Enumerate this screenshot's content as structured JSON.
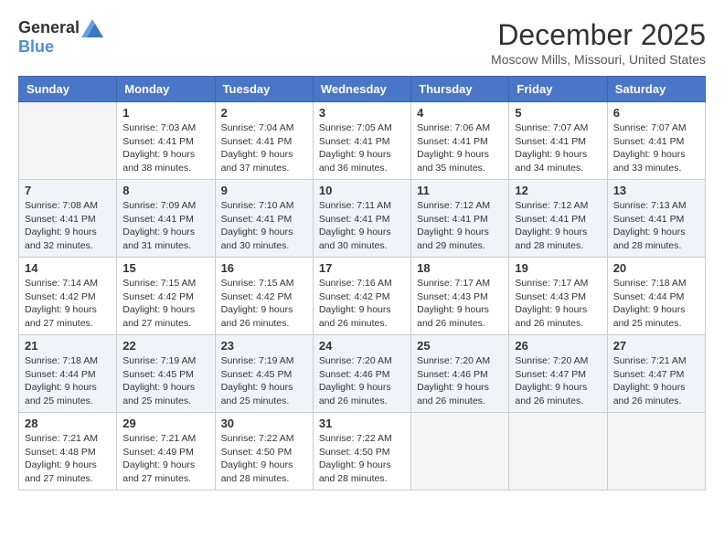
{
  "logo": {
    "general": "General",
    "blue": "Blue"
  },
  "title": "December 2025",
  "location": "Moscow Mills, Missouri, United States",
  "weekdays": [
    "Sunday",
    "Monday",
    "Tuesday",
    "Wednesday",
    "Thursday",
    "Friday",
    "Saturday"
  ],
  "weeks": [
    [
      {
        "day": "",
        "info": ""
      },
      {
        "day": "1",
        "info": "Sunrise: 7:03 AM\nSunset: 4:41 PM\nDaylight: 9 hours\nand 38 minutes."
      },
      {
        "day": "2",
        "info": "Sunrise: 7:04 AM\nSunset: 4:41 PM\nDaylight: 9 hours\nand 37 minutes."
      },
      {
        "day": "3",
        "info": "Sunrise: 7:05 AM\nSunset: 4:41 PM\nDaylight: 9 hours\nand 36 minutes."
      },
      {
        "day": "4",
        "info": "Sunrise: 7:06 AM\nSunset: 4:41 PM\nDaylight: 9 hours\nand 35 minutes."
      },
      {
        "day": "5",
        "info": "Sunrise: 7:07 AM\nSunset: 4:41 PM\nDaylight: 9 hours\nand 34 minutes."
      },
      {
        "day": "6",
        "info": "Sunrise: 7:07 AM\nSunset: 4:41 PM\nDaylight: 9 hours\nand 33 minutes."
      }
    ],
    [
      {
        "day": "7",
        "info": "Sunrise: 7:08 AM\nSunset: 4:41 PM\nDaylight: 9 hours\nand 32 minutes."
      },
      {
        "day": "8",
        "info": "Sunrise: 7:09 AM\nSunset: 4:41 PM\nDaylight: 9 hours\nand 31 minutes."
      },
      {
        "day": "9",
        "info": "Sunrise: 7:10 AM\nSunset: 4:41 PM\nDaylight: 9 hours\nand 30 minutes."
      },
      {
        "day": "10",
        "info": "Sunrise: 7:11 AM\nSunset: 4:41 PM\nDaylight: 9 hours\nand 30 minutes."
      },
      {
        "day": "11",
        "info": "Sunrise: 7:12 AM\nSunset: 4:41 PM\nDaylight: 9 hours\nand 29 minutes."
      },
      {
        "day": "12",
        "info": "Sunrise: 7:12 AM\nSunset: 4:41 PM\nDaylight: 9 hours\nand 28 minutes."
      },
      {
        "day": "13",
        "info": "Sunrise: 7:13 AM\nSunset: 4:41 PM\nDaylight: 9 hours\nand 28 minutes."
      }
    ],
    [
      {
        "day": "14",
        "info": "Sunrise: 7:14 AM\nSunset: 4:42 PM\nDaylight: 9 hours\nand 27 minutes."
      },
      {
        "day": "15",
        "info": "Sunrise: 7:15 AM\nSunset: 4:42 PM\nDaylight: 9 hours\nand 27 minutes."
      },
      {
        "day": "16",
        "info": "Sunrise: 7:15 AM\nSunset: 4:42 PM\nDaylight: 9 hours\nand 26 minutes."
      },
      {
        "day": "17",
        "info": "Sunrise: 7:16 AM\nSunset: 4:42 PM\nDaylight: 9 hours\nand 26 minutes."
      },
      {
        "day": "18",
        "info": "Sunrise: 7:17 AM\nSunset: 4:43 PM\nDaylight: 9 hours\nand 26 minutes."
      },
      {
        "day": "19",
        "info": "Sunrise: 7:17 AM\nSunset: 4:43 PM\nDaylight: 9 hours\nand 26 minutes."
      },
      {
        "day": "20",
        "info": "Sunrise: 7:18 AM\nSunset: 4:44 PM\nDaylight: 9 hours\nand 25 minutes."
      }
    ],
    [
      {
        "day": "21",
        "info": "Sunrise: 7:18 AM\nSunset: 4:44 PM\nDaylight: 9 hours\nand 25 minutes."
      },
      {
        "day": "22",
        "info": "Sunrise: 7:19 AM\nSunset: 4:45 PM\nDaylight: 9 hours\nand 25 minutes."
      },
      {
        "day": "23",
        "info": "Sunrise: 7:19 AM\nSunset: 4:45 PM\nDaylight: 9 hours\nand 25 minutes."
      },
      {
        "day": "24",
        "info": "Sunrise: 7:20 AM\nSunset: 4:46 PM\nDaylight: 9 hours\nand 26 minutes."
      },
      {
        "day": "25",
        "info": "Sunrise: 7:20 AM\nSunset: 4:46 PM\nDaylight: 9 hours\nand 26 minutes."
      },
      {
        "day": "26",
        "info": "Sunrise: 7:20 AM\nSunset: 4:47 PM\nDaylight: 9 hours\nand 26 minutes."
      },
      {
        "day": "27",
        "info": "Sunrise: 7:21 AM\nSunset: 4:47 PM\nDaylight: 9 hours\nand 26 minutes."
      }
    ],
    [
      {
        "day": "28",
        "info": "Sunrise: 7:21 AM\nSunset: 4:48 PM\nDaylight: 9 hours\nand 27 minutes."
      },
      {
        "day": "29",
        "info": "Sunrise: 7:21 AM\nSunset: 4:49 PM\nDaylight: 9 hours\nand 27 minutes."
      },
      {
        "day": "30",
        "info": "Sunrise: 7:22 AM\nSunset: 4:50 PM\nDaylight: 9 hours\nand 28 minutes."
      },
      {
        "day": "31",
        "info": "Sunrise: 7:22 AM\nSunset: 4:50 PM\nDaylight: 9 hours\nand 28 minutes."
      },
      {
        "day": "",
        "info": ""
      },
      {
        "day": "",
        "info": ""
      },
      {
        "day": "",
        "info": ""
      }
    ]
  ]
}
